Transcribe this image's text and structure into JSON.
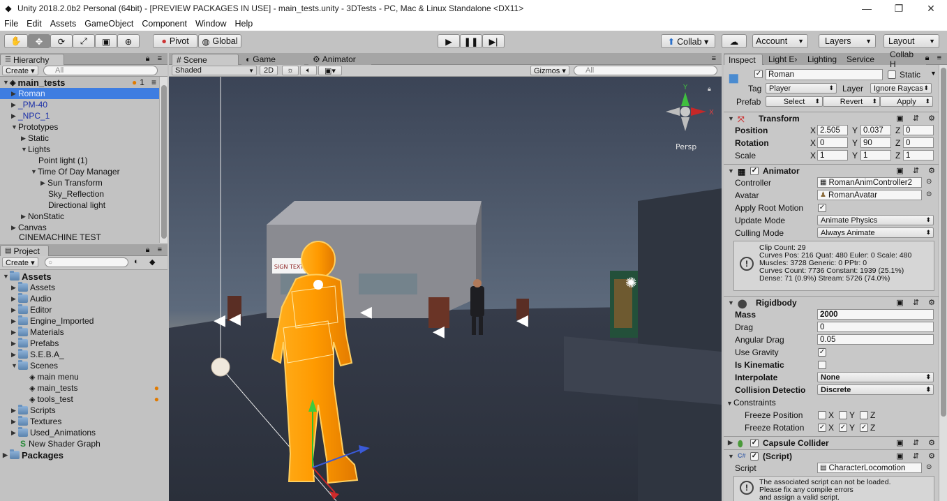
{
  "window": {
    "title": "Unity 2018.2.0b2 Personal (64bit) - [PREVIEW PACKAGES IN USE] - main_tests.unity - 3DTests - PC, Mac & Linux Standalone <DX11>",
    "minimize": "—",
    "maximize": "❐",
    "close": "✕"
  },
  "menu": [
    "File",
    "Edit",
    "Assets",
    "GameObject",
    "Component",
    "Window",
    "Help"
  ],
  "toolbar": {
    "pivot": "Pivot",
    "global": "Global",
    "collab": "Collab ▾",
    "account": "Account",
    "layers": "Layers",
    "layout": "Layout",
    "play_icon": "play-icon",
    "pause_icon": "pause-icon",
    "step_icon": "step-icon"
  },
  "hierarchy": {
    "tab": "Hierarchy",
    "create": "Create ▾",
    "search_placeholder": "All",
    "scene_name": "main_tests",
    "scene_count": "1",
    "items": [
      "Roman",
      "_PM-40",
      "_NPC_1",
      "Prototypes",
      "Static",
      "Lights",
      "Point light (1)",
      "Time Of Day Manager",
      "Sun Transform",
      "Sky_Reflection",
      "Directional light",
      "NonStatic",
      "Canvas",
      "CINEMACHINE TEST"
    ]
  },
  "project": {
    "tab": "Project",
    "create": "Create ▾",
    "items": [
      "Assets",
      "Assets",
      "Audio",
      "Editor",
      "Engine_Imported",
      "Materials",
      "Prefabs",
      "S.E.B.A_",
      "Scenes",
      "main menu",
      "main_tests",
      "tools_test",
      "Scripts",
      "Textures",
      "Used_Animations",
      "New Shader Graph",
      "Packages"
    ]
  },
  "scene": {
    "tabs": [
      "Scene",
      "Game",
      "Animator"
    ],
    "shading": "Shaded",
    "mode2d": "2D",
    "gizmos": "Gizmos ▾",
    "search_placeholder": "All",
    "persp": "Persp",
    "sign_text": "SIGN TEXT"
  },
  "inspector": {
    "tabs": [
      "Inspect",
      "Light E›",
      "Lighting",
      "Service",
      "Collab H"
    ],
    "object_name": "Roman",
    "static": "Static",
    "tag_label": "Tag",
    "tag": "Player",
    "layer_label": "Layer",
    "layer": "Ignore Raycas",
    "prefab_label": "Prefab",
    "prefab_select": "Select",
    "prefab_revert": "Revert",
    "prefab_apply": "Apply",
    "transform": {
      "title": "Transform",
      "position": [
        "2.505",
        "0.037",
        "0"
      ],
      "rotation": [
        "0",
        "90",
        "0"
      ],
      "scale": [
        "1",
        "1",
        "1"
      ],
      "labels": [
        "Position",
        "Rotation",
        "Scale"
      ]
    },
    "animator": {
      "title": "Animator",
      "controller_label": "Controller",
      "controller": "RomanAnimController2",
      "avatar_label": "Avatar",
      "avatar": "RomanAvatar",
      "root_motion_label": "Apply Root Motion",
      "update_label": "Update Mode",
      "update": "Animate Physics",
      "culling_label": "Culling Mode",
      "culling": "Always Animate",
      "info": [
        "Clip Count: 29",
        "Curves Pos: 216 Quat: 480 Euler: 0 Scale: 480",
        "Muscles: 3728 Generic: 0 PPtr: 0",
        "Curves Count: 7736 Constant: 1939 (25.1%)",
        "Dense: 71 (0.9%) Stream: 5726 (74.0%)"
      ]
    },
    "rigidbody": {
      "title": "Rigidbody",
      "mass_label": "Mass",
      "mass": "2000",
      "drag_label": "Drag",
      "drag": "0",
      "angular_label": "Angular Drag",
      "angular": "0.05",
      "gravity_label": "Use Gravity",
      "kinematic_label": "Is Kinematic",
      "interp_label": "Interpolate",
      "interp": "None",
      "collision_label": "Collision Detectio",
      "collision": "Discrete",
      "constraints_label": "Constraints",
      "freeze_pos_label": "Freeze Position",
      "freeze_rot_label": "Freeze Rotation"
    },
    "capsule": {
      "title": "Capsule Collider"
    },
    "script": {
      "title": "(Script)",
      "script_label": "Script",
      "script_value": "CharacterLocomotion",
      "warning": [
        "The associated script can not be loaded.",
        "Please fix any compile errors",
        "and assign a valid script."
      ]
    }
  },
  "axis_labels": {
    "x": "X",
    "y": "Y",
    "z": "Z"
  }
}
